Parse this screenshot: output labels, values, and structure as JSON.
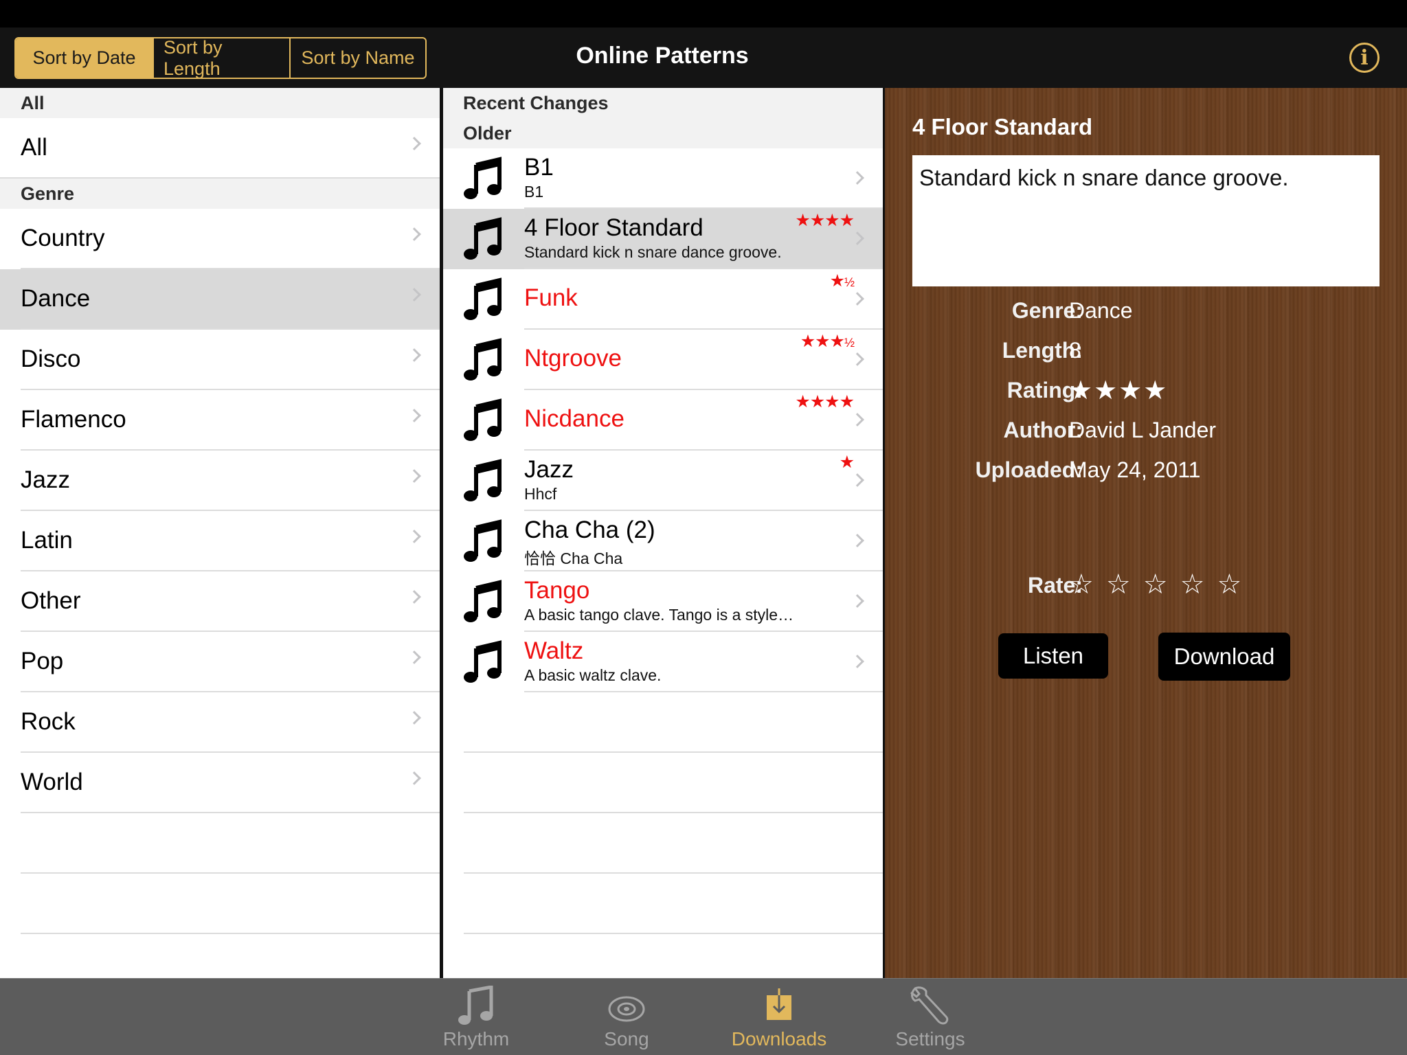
{
  "navbar": {
    "title": "Online Patterns",
    "sort_options": [
      "Sort by Date",
      "Sort by Length",
      "Sort by Name"
    ],
    "info_glyph": "i"
  },
  "categories": {
    "all_header": "All",
    "all_item": "All",
    "genre_header": "Genre",
    "genres": [
      "Country",
      "Dance",
      "Disco",
      "Flamenco",
      "Jazz",
      "Latin",
      "Other",
      "Pop",
      "Rock",
      "World"
    ],
    "selected": "Dance"
  },
  "patterns": {
    "header_recent": "Recent Changes",
    "header_older": "Older",
    "items": [
      {
        "title": "B1",
        "subtitle": "B1",
        "stars": "",
        "half": "",
        "red": false
      },
      {
        "title": "4 Floor Standard",
        "subtitle": "Standard kick n snare dance groove.",
        "stars": "★★★★",
        "half": "",
        "red": false
      },
      {
        "title": "Funk",
        "subtitle": "",
        "stars": "★",
        "half": "½",
        "red": true
      },
      {
        "title": "Ntgroove",
        "subtitle": "",
        "stars": "★★★",
        "half": "½",
        "red": true
      },
      {
        "title": "Nicdance",
        "subtitle": "",
        "stars": "★★★★",
        "half": "",
        "red": true
      },
      {
        "title": "Jazz",
        "subtitle": "Hhcf",
        "stars": "★",
        "half": "",
        "red": false
      },
      {
        "title": "Cha Cha (2)",
        "subtitle": "恰恰 Cha Cha",
        "stars": "",
        "half": "",
        "red": false
      },
      {
        "title": "Tango",
        "subtitle": "A basic tango clave. Tango is a style…",
        "stars": "",
        "half": "",
        "red": true
      },
      {
        "title": "Waltz",
        "subtitle": "A basic waltz clave.",
        "stars": "",
        "half": "",
        "red": true
      }
    ]
  },
  "detail": {
    "title": "4 Floor Standard",
    "description": "Standard kick n snare dance groove.",
    "genre_label": "Genre:",
    "genre_value": "Dance",
    "length_label": "Length:",
    "length_value": "8",
    "rating_label": "Rating:",
    "rating_value": "★★★★",
    "author_label": "Author:",
    "author_value": "David L Jander",
    "uploaded_label": "Uploaded:",
    "uploaded_value": "May 24, 2011",
    "rate_label": "Rate:",
    "rate_stars": [
      "☆",
      "☆",
      "☆",
      "☆",
      "☆"
    ],
    "listen_label": "Listen",
    "download_label": "Download"
  },
  "tabs": {
    "items": [
      {
        "label": "Rhythm",
        "icon": "music-note-icon"
      },
      {
        "label": "Song",
        "icon": "disc-icon"
      },
      {
        "label": "Downloads",
        "icon": "download-icon"
      },
      {
        "label": "Settings",
        "icon": "wrench-icon"
      }
    ],
    "active": "Downloads"
  },
  "colors": {
    "accent": "#e2b85c",
    "new_item_red": "#ee1111",
    "wood": "#6b3f1f"
  }
}
